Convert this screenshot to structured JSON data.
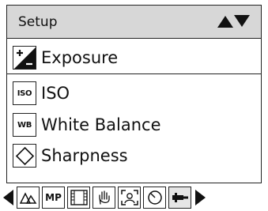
{
  "header": {
    "title": "Setup"
  },
  "menu": {
    "items": [
      {
        "label": "Exposure",
        "icon": "exposure-compensation-icon",
        "selected": true
      },
      {
        "label": "ISO",
        "icon": "iso-icon",
        "icon_text": "ISO"
      },
      {
        "label": "White Balance",
        "icon": "white-balance-icon",
        "icon_text": "WB"
      },
      {
        "label": "Sharpness",
        "icon": "sharpness-icon"
      }
    ]
  },
  "tabs": [
    {
      "icon": "scene-mode-icon"
    },
    {
      "icon": "megapixel-icon",
      "text": "MP"
    },
    {
      "icon": "film-strip-icon"
    },
    {
      "icon": "hand-stabilization-icon"
    },
    {
      "icon": "face-detection-icon"
    },
    {
      "icon": "self-timer-icon"
    },
    {
      "icon": "setup-icon",
      "selected": true
    }
  ]
}
